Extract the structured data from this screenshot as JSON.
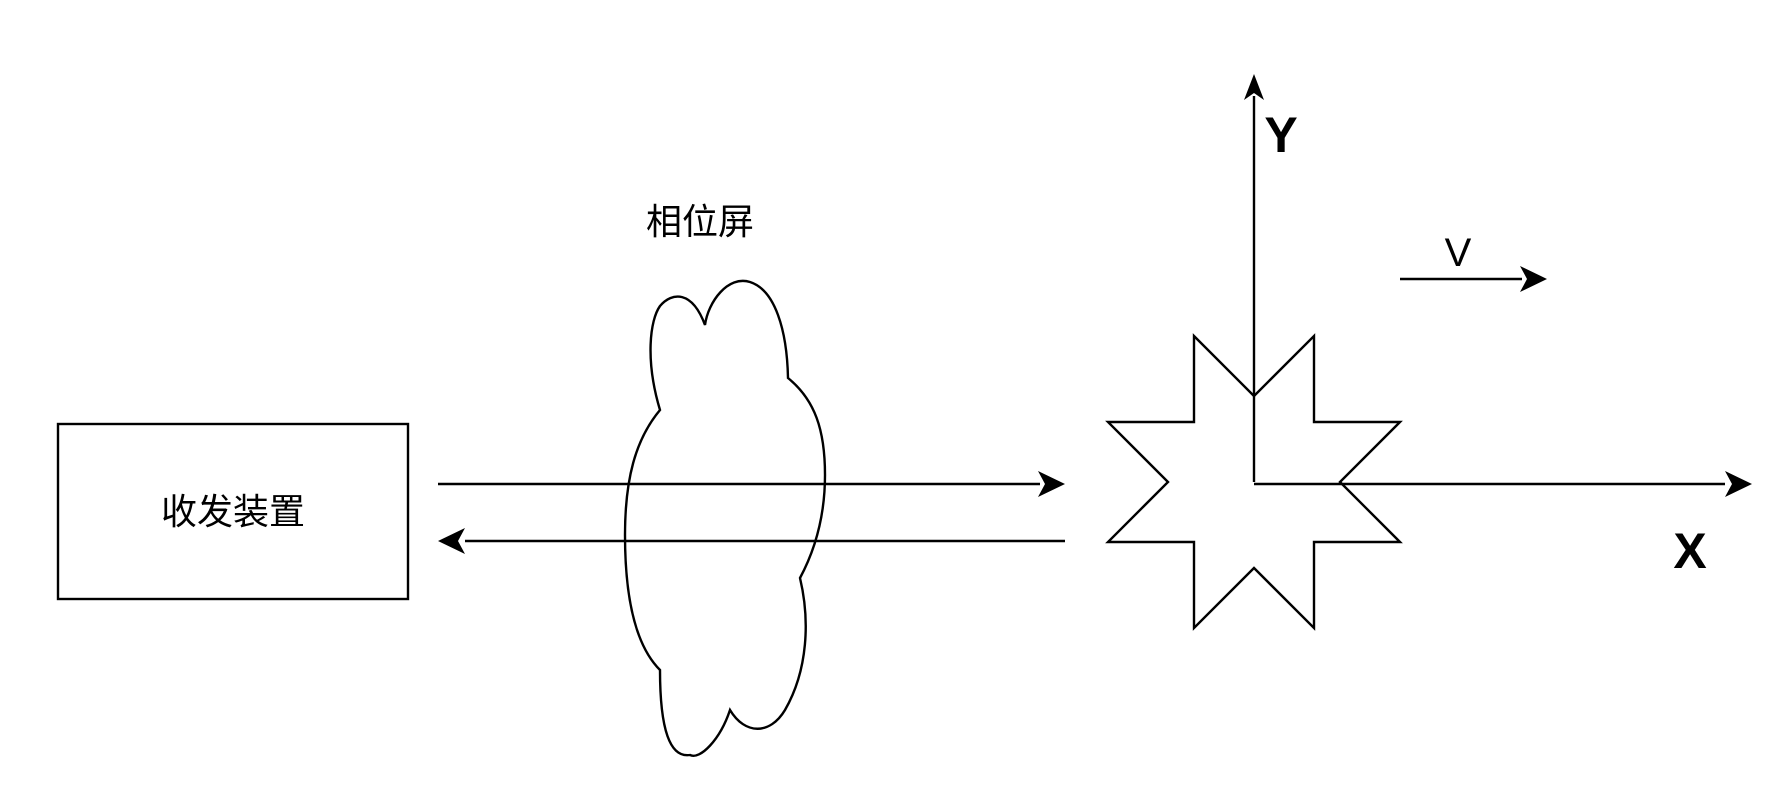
{
  "transceiver": {
    "label": "收发装置"
  },
  "phase_screen": {
    "label": "相位屏"
  },
  "axes": {
    "x_label": "X",
    "y_label": "Y"
  },
  "velocity": {
    "label": "V"
  }
}
